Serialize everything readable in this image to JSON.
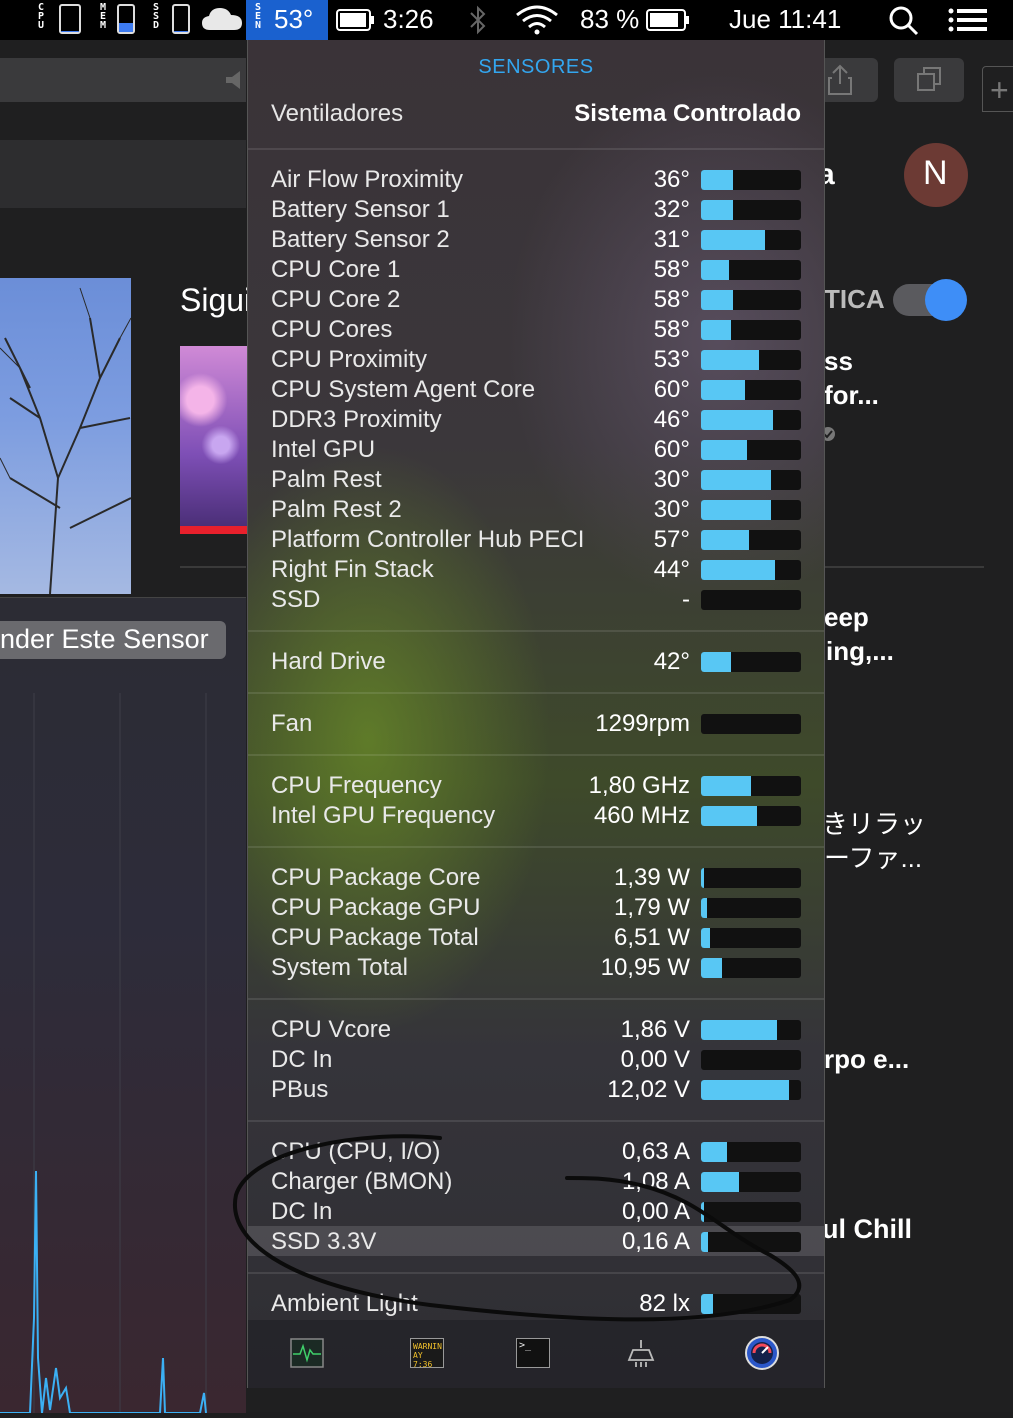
{
  "menubar": {
    "cpu_label": "CPU",
    "mem_label": "MEM",
    "ssd_label": "SSD",
    "sen_label": "SEN",
    "temperature": "53°",
    "battery_time": "3:26",
    "battery_percent": "83 %",
    "clock": "Jue 11:41",
    "meter_levels": {
      "cpu": 0.05,
      "mem": 0.35,
      "ssd": 0.05
    },
    "accent_color": "#1a61cf"
  },
  "background": {
    "heading_partial": "Sigui",
    "sensor_button_partial": "nder Este Sensor",
    "avatar_letter": "N",
    "tica_label": "TICA",
    "text_ss": "ss",
    "text_for": "for...",
    "text_eep": "eep",
    "text_ing": "ing,...",
    "text_jp1": "きリラッ",
    "text_jp2": "ーファ...",
    "text_rpo": "rpo e...",
    "text_chill": "ul Chill",
    "text_a": "a"
  },
  "popup": {
    "title": "SENSORES",
    "fans_label": "Ventiladores",
    "fans_mode": "Sistema Controlado",
    "groups": [
      {
        "rows": [
          {
            "name": "Air Flow Proximity",
            "value": "36°",
            "level": 0.32
          },
          {
            "name": "Battery Sensor 1",
            "value": "32°",
            "level": 0.32
          },
          {
            "name": "Battery Sensor 2",
            "value": "31°",
            "level": 0.64
          },
          {
            "name": "CPU Core 1",
            "value": "58°",
            "level": 0.28
          },
          {
            "name": "CPU Core 2",
            "value": "58°",
            "level": 0.32
          },
          {
            "name": "CPU Cores",
            "value": "58°",
            "level": 0.3
          },
          {
            "name": "CPU Proximity",
            "value": "53°",
            "level": 0.58
          },
          {
            "name": "CPU System Agent Core",
            "value": "60°",
            "level": 0.44
          },
          {
            "name": "DDR3 Proximity",
            "value": "46°",
            "level": 0.72
          },
          {
            "name": "Intel GPU",
            "value": "60°",
            "level": 0.46
          },
          {
            "name": "Palm Rest",
            "value": "30°",
            "level": 0.7
          },
          {
            "name": "Palm Rest 2",
            "value": "30°",
            "level": 0.7
          },
          {
            "name": "Platform Controller Hub PECI",
            "value": "57°",
            "level": 0.48
          },
          {
            "name": "Right Fin Stack",
            "value": "44°",
            "level": 0.74
          },
          {
            "name": "SSD",
            "value": "-",
            "level": 0.0
          }
        ]
      },
      {
        "rows": [
          {
            "name": "Hard Drive",
            "value": "42°",
            "level": 0.3
          }
        ]
      },
      {
        "rows": [
          {
            "name": "Fan",
            "value": "1299rpm",
            "level": 0.0
          }
        ]
      },
      {
        "rows": [
          {
            "name": "CPU Frequency",
            "value": "1,80 GHz",
            "level": 0.5
          },
          {
            "name": "Intel GPU Frequency",
            "value": "460 MHz",
            "level": 0.56
          }
        ]
      },
      {
        "rows": [
          {
            "name": "CPU Package Core",
            "value": "1,39 W",
            "level": 0.03
          },
          {
            "name": "CPU Package GPU",
            "value": "1,79 W",
            "level": 0.06
          },
          {
            "name": "CPU Package Total",
            "value": "6,51 W",
            "level": 0.09
          },
          {
            "name": "System Total",
            "value": "10,95 W",
            "level": 0.21
          }
        ]
      },
      {
        "rows": [
          {
            "name": "CPU Vcore",
            "value": "1,86 V",
            "level": 0.76
          },
          {
            "name": "DC In",
            "value": "0,00 V",
            "level": 0.0
          },
          {
            "name": "PBus",
            "value": "12,02 V",
            "level": 0.88
          }
        ]
      },
      {
        "rows": [
          {
            "name": "CPU (CPU, I/O)",
            "value": "0,63 A",
            "level": 0.26
          },
          {
            "name": "Charger (BMON)",
            "value": "1,08 A",
            "level": 0.38
          },
          {
            "name": "DC In",
            "value": "0,00 A",
            "level": 0.02
          },
          {
            "name": "SSD 3.3V",
            "value": "0,16 A",
            "level": 0.07,
            "highlighted": true
          }
        ]
      },
      {
        "rows": [
          {
            "name": "Ambient Light",
            "value": "82 lx",
            "level": 0.12
          }
        ]
      }
    ],
    "toolbar": {
      "console_text_1": "WARNIN",
      "console_text_2": "AY 7:36",
      "terminal_prompt": ">_"
    },
    "bar_color": "#58c7f4"
  }
}
